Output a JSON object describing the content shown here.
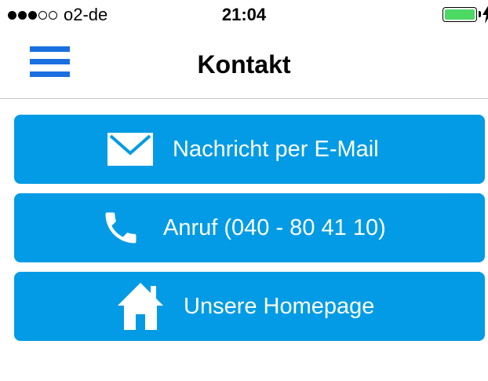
{
  "status_bar": {
    "carrier": "o2-de",
    "time": "21:04",
    "signal_bars_filled": 3,
    "signal_bars_total": 5,
    "battery_level": 1.0,
    "battery_color": "#4cd964"
  },
  "nav": {
    "title": "Kontakt",
    "menu_icon": "hamburger-menu-icon",
    "accent_color": "#1a6fe0"
  },
  "actions": [
    {
      "label": "Nachricht per E-Mail",
      "icon": "mail-icon"
    },
    {
      "label": "Anruf (040 - 80 41 10)",
      "icon": "phone-icon"
    },
    {
      "label": "Unsere Homepage",
      "icon": "home-icon"
    }
  ],
  "colors": {
    "button_background": "#039be5",
    "button_text": "#ffffff"
  }
}
